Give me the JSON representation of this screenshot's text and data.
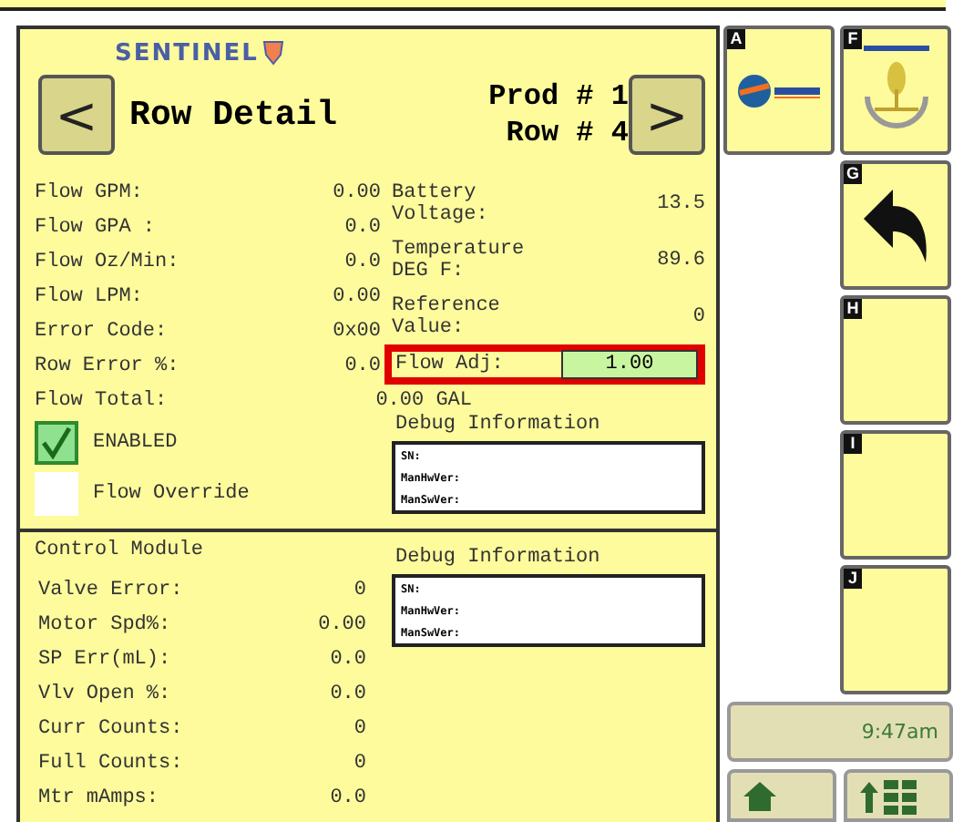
{
  "header": {
    "logo_text": "SENTINEL",
    "prev_button": "<",
    "title": "Row Detail",
    "prod": "Prod # 1",
    "row": "Row # 4",
    "next_button": ">"
  },
  "flow_readings": [
    {
      "label": "Flow GPM:",
      "value": "0.00"
    },
    {
      "label": "Flow GPA :",
      "value": "0.0"
    },
    {
      "label": "Flow Oz/Min:",
      "value": "0.0"
    },
    {
      "label": "Flow LPM:",
      "value": "0.00"
    },
    {
      "label": "Error Code:",
      "value": "0x00"
    },
    {
      "label": "Row Error %:",
      "value": "0.0"
    }
  ],
  "flow_total": {
    "label": "Flow Total:",
    "value": "0.00 GAL"
  },
  "sensor_readings": [
    {
      "label": "Battery Voltage:",
      "value": "13.5"
    },
    {
      "label": "Temperature DEG F:",
      "value": "89.6"
    },
    {
      "label": "Reference Value:",
      "value": "0"
    }
  ],
  "flow_adj": {
    "label": "Flow Adj:",
    "value": "1.00",
    "highlighted": true
  },
  "options": [
    {
      "label": "ENABLED",
      "checked": true
    },
    {
      "label": "Flow Override",
      "checked": false
    }
  ],
  "debug_top": {
    "title": "Debug Information",
    "lines": [
      "SN:",
      "ManHwVer:",
      "ManSwVer:"
    ]
  },
  "control_module": {
    "title": "Control Module",
    "readings": [
      {
        "label": "Valve Error:",
        "value": "0"
      },
      {
        "label": "Motor Spd%:",
        "value": "0.00"
      },
      {
        "label": "SP Err(mL):",
        "value": "0.0"
      },
      {
        "label": "Vlv Open %:",
        "value": "0.0"
      },
      {
        "label": "Curr Counts:",
        "value": "0"
      },
      {
        "label": "Full Counts:",
        "value": "0"
      },
      {
        "label": "Mtr mAmps:",
        "value": "0.0"
      }
    ]
  },
  "debug_bottom": {
    "title": "Debug Information",
    "lines": [
      "SN:",
      "ManHwVer:",
      "ManSwVer:"
    ]
  },
  "softkeys_left": [
    {
      "letter": "A",
      "kind": "logo_round"
    }
  ],
  "softkeys_right": [
    {
      "letter": "F",
      "kind": "logo_wheat"
    },
    {
      "letter": "G",
      "kind": "back"
    },
    {
      "letter": "H",
      "kind": "empty"
    },
    {
      "letter": "I",
      "kind": "empty"
    },
    {
      "letter": "J",
      "kind": "empty"
    }
  ],
  "clock": "9:47am"
}
